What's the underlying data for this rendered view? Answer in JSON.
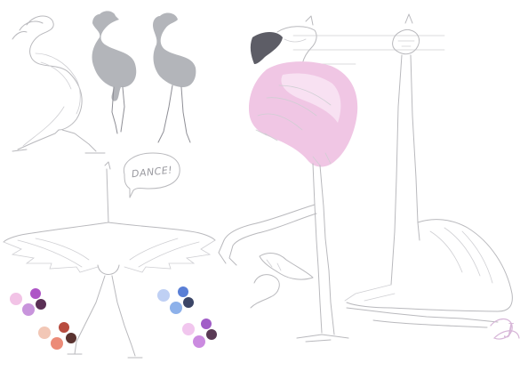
{
  "sketch": {
    "speech_bubble_text": "DANCE!",
    "signature_text": "J"
  },
  "colors": {
    "flamingo_pink": "#f0c6e4",
    "flamingo_pink_light": "#f8e1f2",
    "beak_dark": "#5d5d66",
    "silhouette_grey": "#b3b5ba"
  },
  "palettes": [
    {
      "name": "palette-top-left",
      "colors": [
        "#f2c3e6",
        "#c894dc",
        "#ae55c6",
        "#5a2f55"
      ]
    },
    {
      "name": "palette-bottom-left",
      "colors": [
        "#f2c7b6",
        "#ec8b78",
        "#b84c3f",
        "#5a3330"
      ]
    },
    {
      "name": "palette-top-right",
      "colors": [
        "#bfd0f4",
        "#8db1ea",
        "#5a7fd6",
        "#3b4567"
      ]
    },
    {
      "name": "palette-bottom-right",
      "colors": [
        "#f1c6ee",
        "#cb8be0",
        "#a15dc7",
        "#5a3a55"
      ]
    }
  ]
}
